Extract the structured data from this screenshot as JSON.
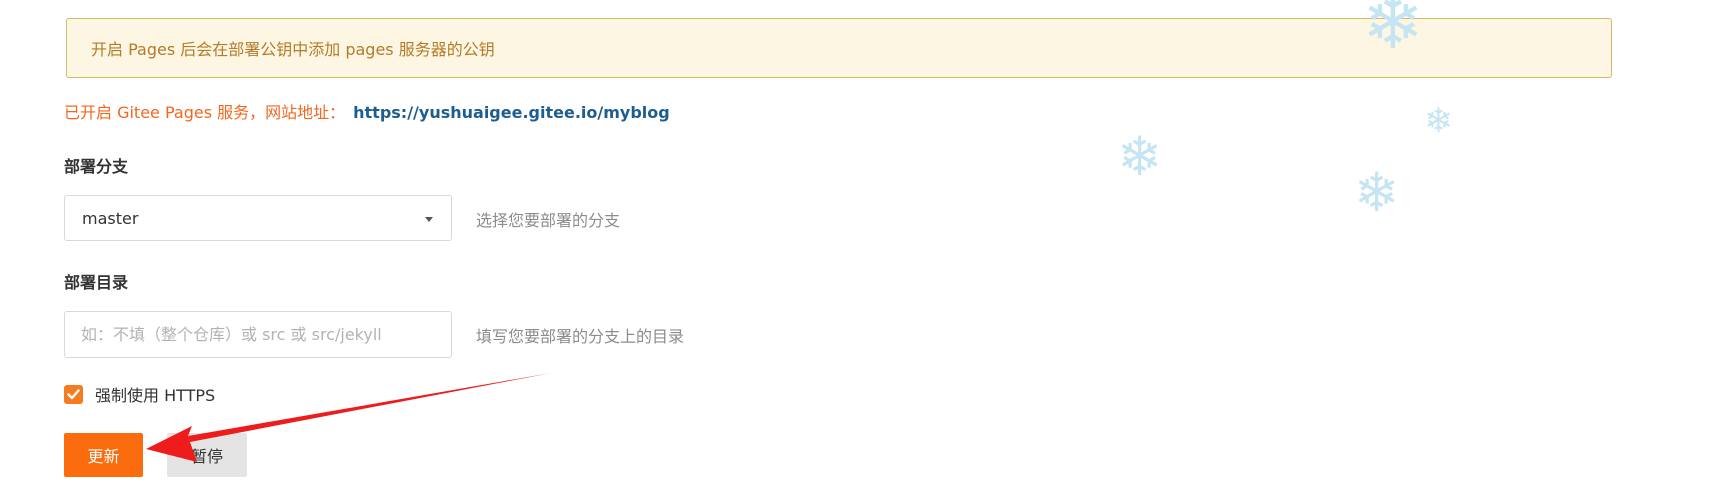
{
  "notice": {
    "text": "开启 Pages 后会在部署公钥中添加 pages 服务器的公钥"
  },
  "status": {
    "text": "已开启 Gitee Pages 服务，网站地址：",
    "url": "https://yushuaigee.gitee.io/myblog"
  },
  "branch": {
    "label": "部署分支",
    "selected": "master",
    "hint": "选择您要部署的分支"
  },
  "directory": {
    "label": "部署目录",
    "value": "",
    "placeholder": "如：不填（整个仓库）或 src 或 src/jekyll",
    "hint": "填写您要部署的分支上的目录"
  },
  "https": {
    "label": "强制使用 HTTPS",
    "checked": true
  },
  "actions": {
    "update_label": "更新",
    "pause_label": "暂停"
  },
  "colors": {
    "accent": "#fa6c0e",
    "arrow": "#ee1c1c",
    "notice_bg": "#fdf6e3",
    "link": "#1d5d8f"
  },
  "icons": {
    "snowflake": "❄",
    "checkbox": "check-icon",
    "dropdown": "chevron-down-icon"
  }
}
